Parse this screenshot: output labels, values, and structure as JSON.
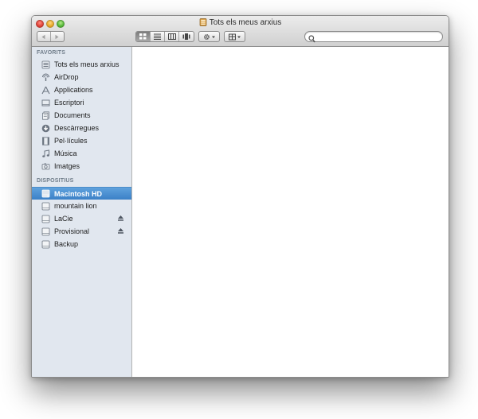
{
  "window": {
    "title": "Tots els meus arxius",
    "title_icon": "all-my-files-icon"
  },
  "toolbar": {
    "nav": [
      "back-arrow-icon",
      "forward-arrow-icon"
    ],
    "view_modes": [
      "icon-view-icon",
      "list-view-icon",
      "column-view-icon",
      "coverflow-view-icon"
    ],
    "active_view": "icon-view",
    "action_menu_icon": "gear-icon",
    "arrange_menu_icon": "arrange-icon",
    "search": {
      "value": "",
      "placeholder": ""
    }
  },
  "sidebar": {
    "favorites_header": "FAVORITS",
    "favorites": [
      {
        "label": "Tots els meus arxius",
        "icon": "all-files-icon"
      },
      {
        "label": "AirDrop",
        "icon": "airdrop-icon"
      },
      {
        "label": "Applications",
        "icon": "applications-icon"
      },
      {
        "label": "Escriptori",
        "icon": "desktop-icon"
      },
      {
        "label": "Documents",
        "icon": "documents-icon"
      },
      {
        "label": "Descàrregues",
        "icon": "downloads-icon"
      },
      {
        "label": "Pel·lícules",
        "icon": "movies-icon"
      },
      {
        "label": "Música",
        "icon": "music-icon"
      },
      {
        "label": "Imatges",
        "icon": "pictures-icon"
      }
    ],
    "devices_header": "DISPOSITIUS",
    "devices": [
      {
        "label": "Macintosh HD",
        "icon": "hard-drive-icon",
        "selected": true,
        "eject": false
      },
      {
        "label": "mountain lion",
        "icon": "disk-icon",
        "selected": false,
        "eject": false
      },
      {
        "label": "LaCie",
        "icon": "disk-icon",
        "selected": false,
        "eject": true
      },
      {
        "label": "Provisional",
        "icon": "disk-icon",
        "selected": false,
        "eject": true
      },
      {
        "label": "Backup",
        "icon": "disk-icon",
        "selected": false,
        "eject": false
      }
    ]
  },
  "colors": {
    "sidebar_bg": "#e1e7ef",
    "selection": "#3b80c7",
    "section_header": "#717e8b"
  }
}
